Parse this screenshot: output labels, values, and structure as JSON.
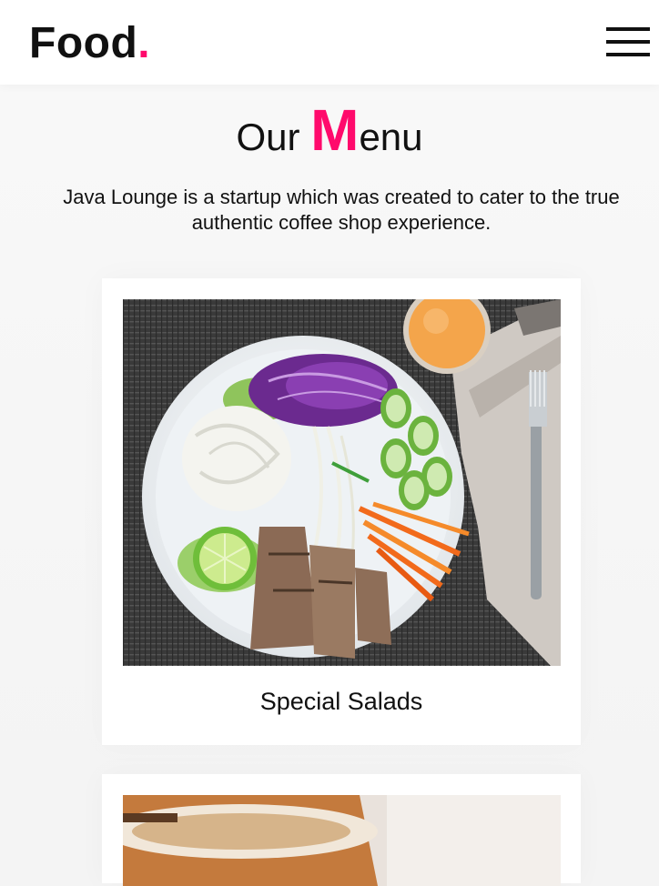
{
  "header": {
    "logo_text": "Food",
    "logo_dot": ".",
    "menu_icon": "hamburger-menu-icon"
  },
  "section": {
    "title_prefix": "Our ",
    "title_initial": "M",
    "title_rest": "enu",
    "description": "Java Lounge is a startup which was created to cater to the true authentic coffee shop experience."
  },
  "menu_items": [
    {
      "label": "Special Salads",
      "image": "salad-bowl-photo"
    },
    {
      "label": "",
      "image": "coffee-cup-photo"
    }
  ],
  "colors": {
    "accent": "#ff0a6c",
    "text": "#111111",
    "background": "#f4f4f4",
    "card": "#ffffff"
  }
}
